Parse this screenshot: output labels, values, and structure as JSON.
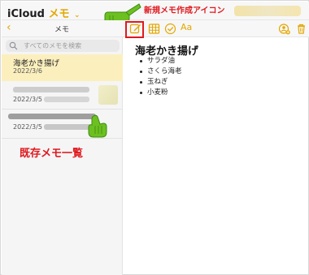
{
  "app": {
    "brand_icloud": "iCloud",
    "brand_memo": "メモ",
    "brand_chevron": "⌄"
  },
  "annotations": {
    "new_note_icon": "新規メモ作成アイコン",
    "existing_notes_list": "既存メモ一覧"
  },
  "toolbar": {
    "back_icon": "chevron-left-icon",
    "list_title": "メモ",
    "icons": [
      "new-note-icon",
      "table-icon",
      "checklist-icon",
      "format-icon",
      "share-icon",
      "trash-icon"
    ],
    "format_label": "Aa"
  },
  "sidebar": {
    "search_placeholder": "すべてのメモを検索",
    "notes": [
      {
        "title": "海老かき揚げ",
        "date": "2022/3/6"
      },
      {
        "title": "",
        "date": "2022/3/5"
      },
      {
        "title": "",
        "date": "2022/3/5"
      }
    ]
  },
  "note": {
    "title": "海老かき揚げ",
    "items": [
      "サラダ油",
      "さくら海老",
      "玉ねぎ",
      "小麦粉"
    ]
  },
  "colors": {
    "accent": "#e4a700",
    "annotation_red": "#e0191e",
    "selected_note_bg": "#fbefbe",
    "pointer_green": "#6cc020"
  }
}
